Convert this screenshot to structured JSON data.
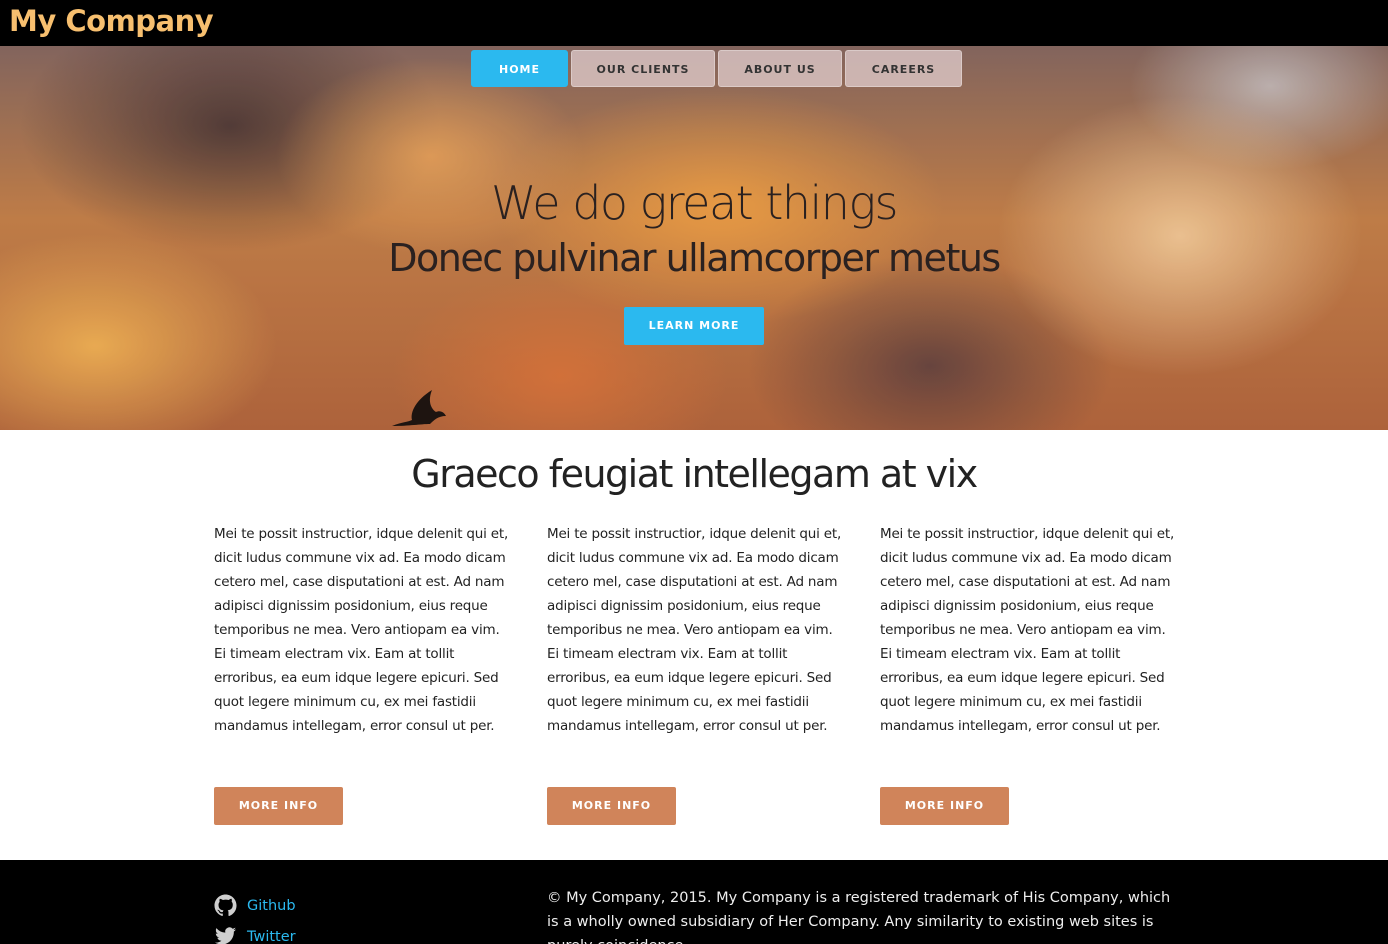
{
  "header": {
    "brand": "My Company"
  },
  "nav": {
    "items": [
      {
        "label": "HOME"
      },
      {
        "label": "OUR CLIENTS"
      },
      {
        "label": "ABOUT US"
      },
      {
        "label": "CAREERS"
      }
    ],
    "active_index": 0
  },
  "hero": {
    "title": "We do great things",
    "subtitle": "Donec pulvinar ullamcorper metus",
    "cta_label": "LEARN MORE"
  },
  "features": {
    "title": "Graeco feugiat intellegam at vix",
    "columns": [
      {
        "text": "Mei te possit instructior, idque delenit qui et, dicit ludus commune vix ad. Ea modo dicam cetero mel, case disputationi at est. Ad nam adipisci dignissim posidonium, eius reque temporibus ne mea. Vero antiopam ea vim. Ei timeam electram vix. Eam at tollit erroribus, ea eum idque legere epicuri. Sed quot legere minimum cu, ex mei fastidii mandamus intellegam, error consul ut per.",
        "button": "MORE INFO"
      },
      {
        "text": "Mei te possit instructior, idque delenit qui et, dicit ludus commune vix ad. Ea modo dicam cetero mel, case disputationi at est. Ad nam adipisci dignissim posidonium, eius reque temporibus ne mea. Vero antiopam ea vim. Ei timeam electram vix. Eam at tollit erroribus, ea eum idque legere epicuri. Sed quot legere minimum cu, ex mei fastidii mandamus intellegam, error consul ut per.",
        "button": "MORE INFO"
      },
      {
        "text": "Mei te possit instructior, idque delenit qui et, dicit ludus commune vix ad. Ea modo dicam cetero mel, case disputationi at est. Ad nam adipisci dignissim posidonium, eius reque temporibus ne mea. Vero antiopam ea vim. Ei timeam electram vix. Eam at tollit erroribus, ea eum idque legere epicuri. Sed quot legere minimum cu, ex mei fastidii mandamus intellegam, error consul ut per.",
        "button": "MORE INFO"
      }
    ]
  },
  "footer": {
    "links": [
      {
        "label": "Github",
        "icon": "github-icon"
      },
      {
        "label": "Twitter",
        "icon": "twitter-icon"
      }
    ],
    "copyright": "© My Company, 2015. My Company is a registered trademark of His Company, which is a wholly owned subsidiary of Her Company. Any similarity to existing web sites is purely coincidence."
  },
  "colors": {
    "brand": "#f7bf6f",
    "accent": "#2bb9ef",
    "button": "#d0845a",
    "bar": "#000000"
  }
}
